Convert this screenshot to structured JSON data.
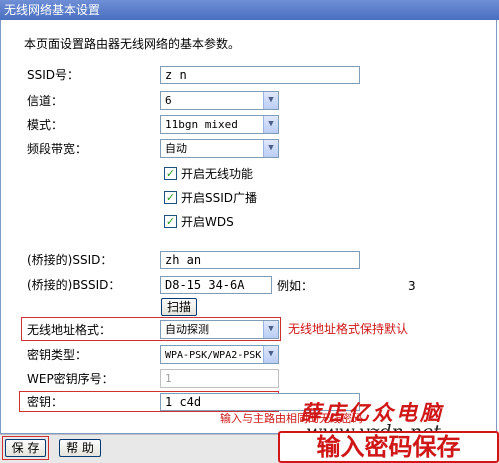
{
  "window_title": "无线网络基本设置",
  "intro": "本页面设置路由器无线网络的基本参数。",
  "fields": {
    "ssid": {
      "label": "SSID号：",
      "value": "z     n"
    },
    "channel": {
      "label": "信道：",
      "value": "6"
    },
    "mode": {
      "label": "模式：",
      "value": "11bgn mixed"
    },
    "bandwidth": {
      "label": "频段带宽：",
      "value": "自动"
    },
    "bridge_ssid": {
      "label": "(桥接的)SSID：",
      "value": "zh    an"
    },
    "bridge_bssid": {
      "label": "(桥接的)BSSID：",
      "value": "D8-15      34-6A",
      "example": "例如：",
      "example_value": "3"
    },
    "addr_format": {
      "label": "无线地址格式：",
      "value": "自动探测",
      "note": "无线地址格式保持默认"
    },
    "key_type": {
      "label": "密钥类型：",
      "value": "WPA-PSK/WPA2-PSK"
    },
    "wep_index": {
      "label": "WEP密钥序号：",
      "value": "1"
    },
    "key": {
      "label": "密钥：",
      "value": "1     c4d",
      "hint": "输入与主路由相同的无线密码"
    }
  },
  "checkboxes": [
    {
      "label": "开启无线功能",
      "checked": true
    },
    {
      "label": "开启SSID广播",
      "checked": true
    },
    {
      "label": "开启WDS",
      "checked": true
    }
  ],
  "buttons": {
    "scan": "扫描",
    "save": "保 存",
    "help": "帮 助"
  },
  "watermark": {
    "line1": "薛店亿众电脑",
    "line2": "www.yzdn.net",
    "banner": "输入密码保存"
  },
  "colors": {
    "accent_red": "#d01616",
    "title_blue": "#5a7cc9"
  }
}
